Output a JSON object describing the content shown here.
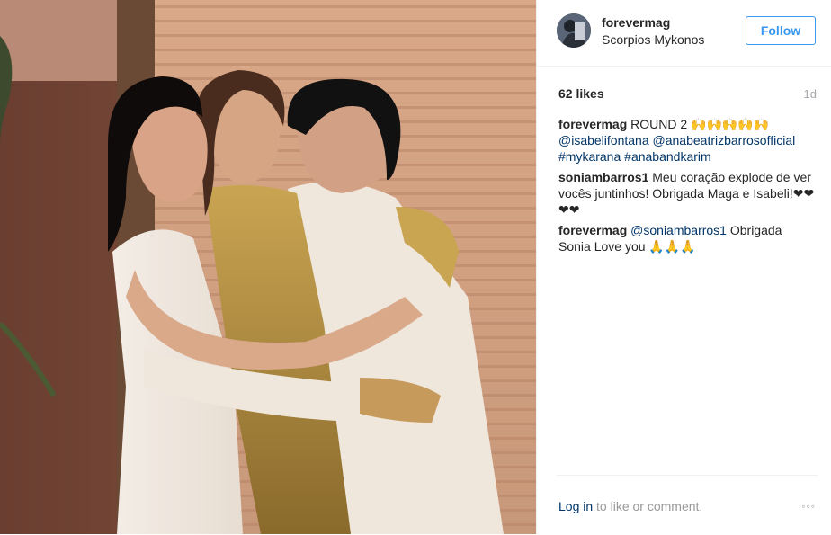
{
  "header": {
    "username": "forevermag",
    "location": "Scorpios Mykonos",
    "follow_label": "Follow"
  },
  "stats": {
    "likes": "62 likes",
    "age": "1d"
  },
  "comments": [
    {
      "user": "forevermag",
      "text_parts": [
        "ROUND 2 🙌🙌🙌🙌🙌"
      ],
      "mentions": [
        "@isabelifontana",
        "@anabeatrizbarrosofficial",
        "#mykarana",
        "#anabandkarim"
      ]
    },
    {
      "user": "soniambarros1",
      "text": "Meu coração explode de ver vocês juntinhos! Obrigada Maga e Isabeli!❤❤❤❤"
    },
    {
      "user": "forevermag",
      "mention": "@soniambarros1",
      "text": "Obrigada Sonia Love you 🙏🙏🙏"
    }
  ],
  "footer": {
    "login_label": "Log in",
    "login_suffix": "to like or comment.",
    "more_label": "◦◦◦"
  },
  "photo": {
    "description_icon": "photo-image"
  },
  "colors": {
    "accent": "#3897f0",
    "link": "#003569",
    "muted": "#999999",
    "divider": "#efefef"
  }
}
